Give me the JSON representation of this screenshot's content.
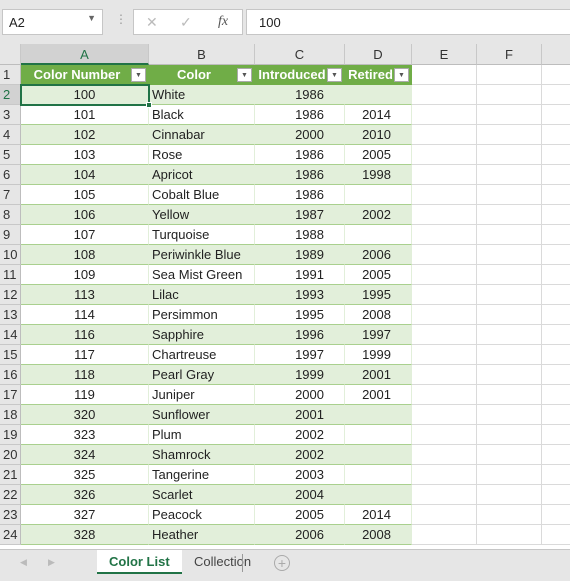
{
  "name_box": "A2",
  "formula_bar": {
    "cancel_icon": "✕",
    "enter_icon": "✓",
    "fx_label": "fx",
    "value": "100"
  },
  "columns": [
    "A",
    "B",
    "C",
    "D",
    "E",
    "F"
  ],
  "selected_cell": "A2",
  "table": {
    "headers": [
      "Color Number",
      "Color",
      "Introduced",
      "Retired"
    ],
    "rows": [
      [
        "100",
        "White",
        "1986",
        ""
      ],
      [
        "101",
        "Black",
        "1986",
        "2014"
      ],
      [
        "102",
        "Cinnabar",
        "2000",
        "2010"
      ],
      [
        "103",
        "Rose",
        "1986",
        "2005"
      ],
      [
        "104",
        "Apricot",
        "1986",
        "1998"
      ],
      [
        "105",
        "Cobalt Blue",
        "1986",
        ""
      ],
      [
        "106",
        "Yellow",
        "1987",
        "2002"
      ],
      [
        "107",
        "Turquoise",
        "1988",
        ""
      ],
      [
        "108",
        "Periwinkle Blue",
        "1989",
        "2006"
      ],
      [
        "109",
        "Sea Mist Green",
        "1991",
        "2005"
      ],
      [
        "113",
        "Lilac",
        "1993",
        "1995"
      ],
      [
        "114",
        "Persimmon",
        "1995",
        "2008"
      ],
      [
        "116",
        "Sapphire",
        "1996",
        "1997"
      ],
      [
        "117",
        "Chartreuse",
        "1997",
        "1999"
      ],
      [
        "118",
        "Pearl Gray",
        "1999",
        "2001"
      ],
      [
        "119",
        "Juniper",
        "2000",
        "2001"
      ],
      [
        "320",
        "Sunflower",
        "2001",
        ""
      ],
      [
        "323",
        "Plum",
        "2002",
        ""
      ],
      [
        "324",
        "Shamrock",
        "2002",
        ""
      ],
      [
        "325",
        "Tangerine",
        "2003",
        ""
      ],
      [
        "326",
        "Scarlet",
        "2004",
        ""
      ],
      [
        "327",
        "Peacock",
        "2005",
        "2014"
      ],
      [
        "328",
        "Heather",
        "2006",
        "2008"
      ]
    ]
  },
  "sheets": [
    {
      "label": "Color List",
      "active": true
    },
    {
      "label": "Collection",
      "active": false
    }
  ],
  "colors": {
    "header": "#70AD47",
    "band": "#E2EFDA",
    "accent": "#217346"
  }
}
